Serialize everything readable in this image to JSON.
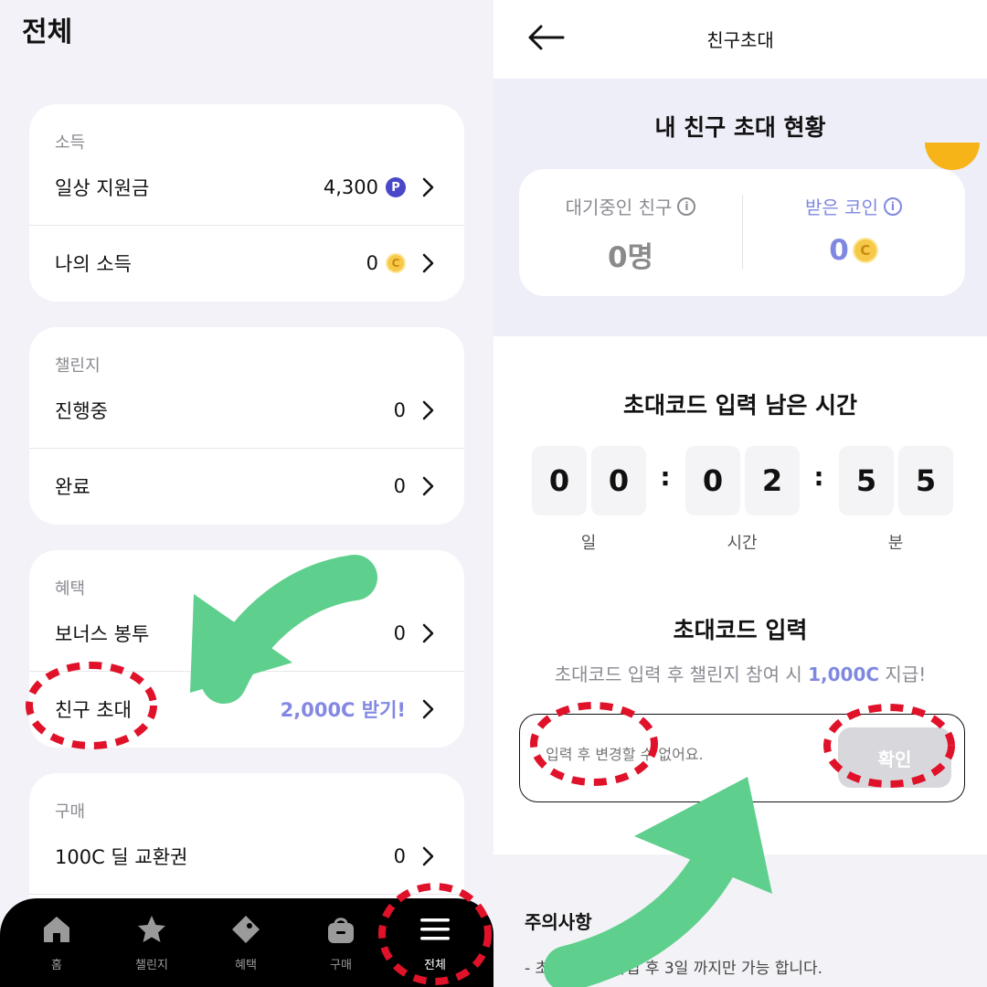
{
  "left": {
    "title": "전체",
    "income": {
      "label": "소득",
      "rows": [
        {
          "label": "일상 지원금",
          "value": "4,300",
          "badge": "P"
        },
        {
          "label": "나의 소득",
          "value": "0",
          "badge": "C"
        }
      ]
    },
    "challenge": {
      "label": "챌린지",
      "rows": [
        {
          "label": "진행중",
          "value": "0"
        },
        {
          "label": "완료",
          "value": "0"
        }
      ]
    },
    "benefit": {
      "label": "혜택",
      "rows": [
        {
          "label": "보너스 봉투",
          "value": "0"
        },
        {
          "label": "친구 초대",
          "value": "2,000C 받기!"
        }
      ]
    },
    "purchase": {
      "label": "구매",
      "rows": [
        {
          "label": "100C 딜 교환권",
          "value": "0"
        }
      ]
    },
    "tabs": [
      {
        "label": "홈",
        "icon": "home-icon"
      },
      {
        "label": "챌린지",
        "icon": "star-icon"
      },
      {
        "label": "혜택",
        "icon": "tag-icon"
      },
      {
        "label": "구매",
        "icon": "bag-icon"
      },
      {
        "label": "전체",
        "icon": "menu-icon"
      }
    ]
  },
  "right": {
    "title": "친구초대",
    "status_title": "내 친구 초대 현황",
    "pending_label": "대기중인 친구",
    "pending_value": "0명",
    "coins_label": "받은 코인",
    "coins_value": "0",
    "coin_badge": "C",
    "info_glyph": "i",
    "timer_title": "초대코드 입력 남은 시간",
    "timer_digits": [
      "0",
      "0",
      "0",
      "2",
      "5",
      "5"
    ],
    "timer_sep": ":",
    "timer_units": [
      "일",
      "시간",
      "분"
    ],
    "code_title": "초대코드 입력",
    "code_desc_pre": "초대코드 입력 후 챌린지 참여 시 ",
    "code_desc_amount": "1,000C",
    "code_desc_post": " 지급!",
    "code_placeholder": "입력 후 변경할 수 없어요.",
    "confirm_label": "확인",
    "notice_title": "주의사항",
    "notice_item": "-  초대코드는 가입 후 3일 까지만 가능 합니다."
  },
  "colors": {
    "accent": "#7f88e0",
    "annotation_red": "#e0122a",
    "annotation_green": "#5fcf8d"
  }
}
